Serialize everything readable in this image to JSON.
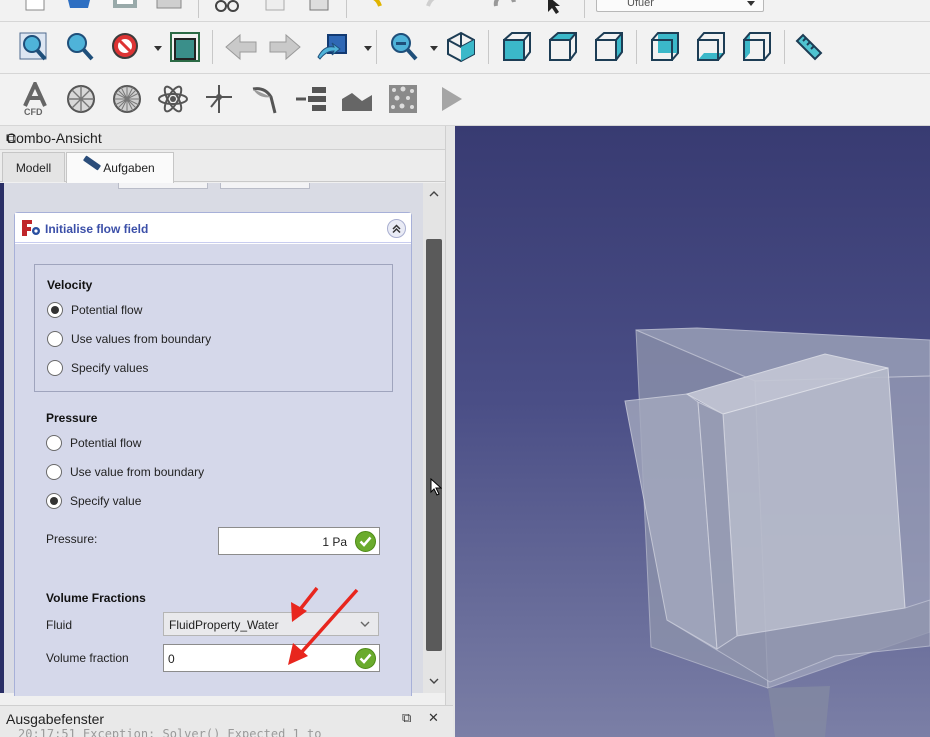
{
  "toolbar_top": {
    "combo_value": "Ufuer"
  },
  "toolbar_icons": {
    "row2": [
      "fit-all-icon",
      "fit-selection-icon",
      "draw-style-icon",
      "bounding-box-icon",
      "back-icon",
      "forward-icon",
      "sync-view-icon",
      "zoom-icon",
      "isometric-view-icon",
      "front-view-icon",
      "top-view-icon",
      "right-view-icon",
      "rear-view-icon",
      "bottom-view-icon",
      "left-view-icon",
      "measure-icon"
    ],
    "row3": [
      "cfd-analysis-icon",
      "mesh-icon",
      "mesh-refine-icon",
      "physics-model-icon",
      "fluid-material-icon",
      "initial-conditions-icon",
      "boundary-icon",
      "zone-icon",
      "porous-icon",
      "solver-icon",
      "run-icon"
    ]
  },
  "combo_view": {
    "title": "Combo-Ansicht",
    "tabs": [
      {
        "label": "Modell",
        "active": false
      },
      {
        "label": "Aufgaben",
        "active": true
      }
    ]
  },
  "task_panel": {
    "title": "Initialise flow field",
    "velocity": {
      "heading": "Velocity",
      "options": [
        {
          "label": "Potential flow",
          "checked": true
        },
        {
          "label": "Use values from boundary",
          "checked": false
        },
        {
          "label": "Specify values",
          "checked": false
        }
      ]
    },
    "pressure": {
      "heading": "Pressure",
      "options": [
        {
          "label": "Potential flow",
          "checked": false
        },
        {
          "label": "Use value from boundary",
          "checked": false
        },
        {
          "label": "Specify value",
          "checked": true
        }
      ],
      "field_label": "Pressure:",
      "field_value": "1 Pa"
    },
    "volume_fractions": {
      "heading": "Volume Fractions",
      "fluid_label": "Fluid",
      "fluid_value": "FluidProperty_Water",
      "fraction_label": "Volume fraction",
      "fraction_value": "0"
    }
  },
  "output_window": {
    "title": "Ausgabefenster",
    "line": "20:17:51  Exception: Solver() Expected 1 to"
  },
  "colors": {
    "accent": "#3b4fa8",
    "annotation": "#e8261e",
    "ok": "#6aab2d",
    "viewport_top": "#383b72"
  }
}
